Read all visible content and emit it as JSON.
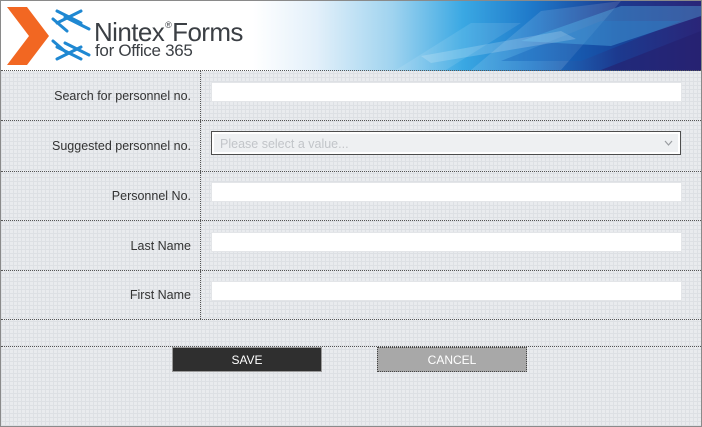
{
  "branding": {
    "title_main": "Nintex",
    "title_reg": "®",
    "title_product": "Forms",
    "subtitle": "for Office 365"
  },
  "form": {
    "search_personnel": {
      "label": "Search for personnel no.",
      "value": ""
    },
    "suggested_personnel": {
      "label": "Suggested personnel no.",
      "placeholder": "Please select a value..."
    },
    "personnel_no": {
      "label": "Personnel No.",
      "value": ""
    },
    "last_name": {
      "label": "Last Name",
      "value": ""
    },
    "first_name": {
      "label": "First Name",
      "value": ""
    }
  },
  "buttons": {
    "save": "SAVE",
    "cancel": "CANCEL"
  },
  "icons": {
    "logo": "nintex-logo-icon",
    "dropdown": "chevron-down-icon"
  },
  "colors": {
    "logo_orange": "#f26722",
    "logo_blue": "#1f88d2",
    "banner_dark": "#2a2578",
    "save_bg": "#2f2f2f",
    "cancel_bg": "#a8a8a8"
  }
}
